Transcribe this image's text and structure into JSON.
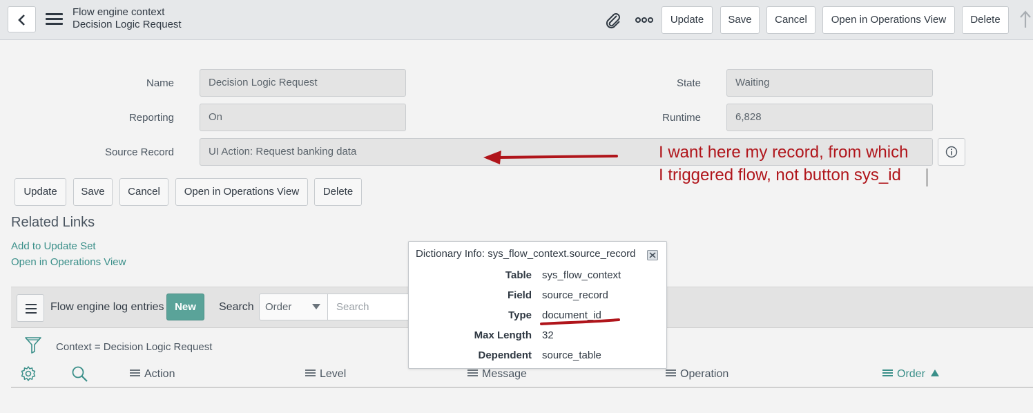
{
  "header": {
    "title": "Flow engine context",
    "subtitle": "Decision Logic Request",
    "buttons": [
      "Update",
      "Save",
      "Cancel",
      "Open in Operations View",
      "Delete"
    ]
  },
  "form": {
    "name": {
      "label": "Name",
      "value": "Decision Logic Request"
    },
    "reporting": {
      "label": "Reporting",
      "value": "On"
    },
    "source_record": {
      "label": "Source Record",
      "value": "UI Action: Request banking data"
    },
    "state": {
      "label": "State",
      "value": "Waiting"
    },
    "runtime": {
      "label": "Runtime",
      "value": "6,828"
    },
    "buttons": [
      "Update",
      "Save",
      "Cancel",
      "Open in Operations View",
      "Delete"
    ]
  },
  "related_links": {
    "title": "Related Links",
    "links": [
      "Add to Update Set",
      "Open in Operations View"
    ]
  },
  "related_list": {
    "title": "Flow engine log entries",
    "new_label": "New",
    "search_label": "Search",
    "search_field": "Order",
    "search_placeholder": "Search",
    "filter_text": "Context = Decision Logic Request",
    "columns": [
      "Action",
      "Level",
      "Message",
      "Operation",
      "Order"
    ],
    "sorted_column": "Order",
    "sort_direction": "ascending"
  },
  "dictionary_popup": {
    "title": "Dictionary Info: sys_flow_context.source_record",
    "rows": [
      {
        "key": "Table",
        "value": "sys_flow_context"
      },
      {
        "key": "Field",
        "value": "source_record"
      },
      {
        "key": "Type",
        "value": "document_id"
      },
      {
        "key": "Max Length",
        "value": "32"
      },
      {
        "key": "Dependent",
        "value": "source_table"
      }
    ]
  },
  "annotation": {
    "line1": "I want here my record, from which",
    "line2": "I triggered flow, not button sys_id",
    "color": "#b0151b"
  },
  "colors": {
    "accent": "#3a8f89",
    "new_button": "#5aa399",
    "header_bg": "#e6e8ea",
    "page_bg": "#f3f3f3"
  }
}
